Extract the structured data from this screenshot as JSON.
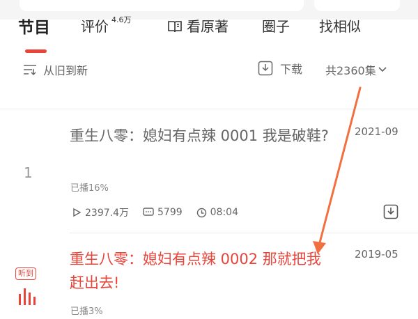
{
  "tabs": [
    {
      "label": "节目"
    },
    {
      "label": "评价",
      "badge": "4.6万"
    },
    {
      "label": "看原著"
    },
    {
      "label": "圈子"
    },
    {
      "label": "找相似"
    }
  ],
  "sortbar": {
    "order_label": "从旧到新",
    "download_label": "下载",
    "count_label": "共2360集"
  },
  "episodes": [
    {
      "index": "1",
      "title": "重生八零：媳妇有点辣 0001 我是破鞋?",
      "date": "2021-09",
      "progress": "已播16%",
      "plays": "2397.4万",
      "comments": "5799",
      "duration": "08:04"
    },
    {
      "listening_badge": "听到",
      "title": "重生八零：媳妇有点辣 0002 那就把我赶出去!",
      "date": "2019-05",
      "progress": "已播3%"
    }
  ],
  "colors": {
    "accent": "#e8443a",
    "annotation": "#f07040"
  }
}
